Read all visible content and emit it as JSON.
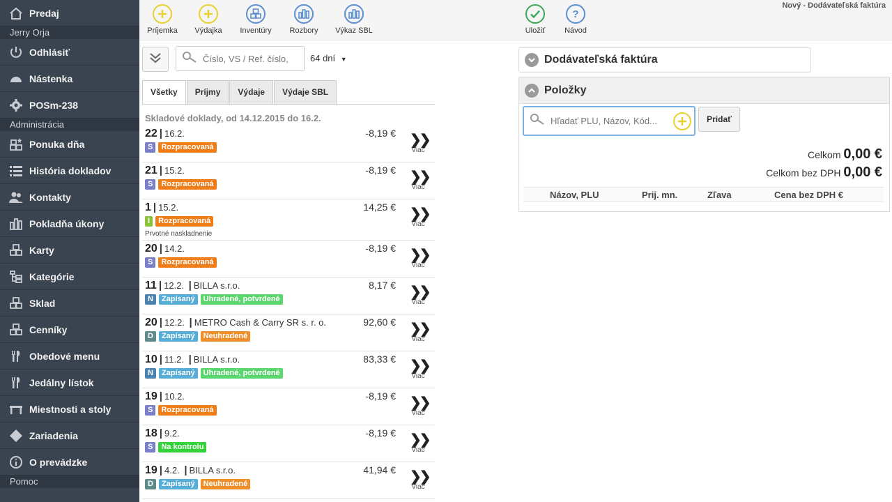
{
  "sidebar": {
    "items": [
      {
        "label": "Predaj",
        "icon": "home-icon"
      },
      {
        "section": "Jerry Orja"
      },
      {
        "label": "Odhlásiť",
        "icon": "power-icon"
      },
      {
        "label": "Nástenka",
        "icon": "dashboard-icon"
      },
      {
        "label": "POSm-238",
        "icon": "gear-icon"
      },
      {
        "section": "Administrácia"
      },
      {
        "label": "Ponuka dňa",
        "icon": "blocks-star-icon"
      },
      {
        "label": "História dokladov",
        "icon": "list-icon"
      },
      {
        "label": "Kontakty",
        "icon": "users-icon"
      },
      {
        "label": "Pokladňa úkony",
        "icon": "bars-icon"
      },
      {
        "label": "Karty",
        "icon": "blocks-icon"
      },
      {
        "label": "Kategórie",
        "icon": "tree-icon"
      },
      {
        "label": "Sklad",
        "icon": "blocks-icon"
      },
      {
        "label": "Cenníky",
        "icon": "blocks-icon"
      },
      {
        "label": "Obedové menu",
        "icon": "cutlery-icon"
      },
      {
        "label": "Jedálny lístok",
        "icon": "cutlery-icon"
      },
      {
        "label": "Miestnosti a stoly",
        "icon": "table-icon"
      },
      {
        "label": "Zariadenia",
        "icon": "diamond-icon"
      },
      {
        "label": "O prevádzke",
        "icon": "info-icon"
      },
      {
        "section": "Pomoc"
      }
    ]
  },
  "toolbar": {
    "prijemka": "Príjemka",
    "vydajka": "Výdajka",
    "inventury": "Inventúry",
    "rozbory": "Rozbory",
    "vykaz": "Výkaz SBL",
    "ulozit": "Uložiť",
    "navod": "Návod",
    "title": "Nový - Dodávateľská faktúra"
  },
  "list": {
    "search_placeholder": "Číslo, VS / Ref. číslo,",
    "days": "64 dní",
    "tabs": [
      "Všetky",
      "Príjmy",
      "Výdaje",
      "Výdaje SBL"
    ],
    "header": "Skladové doklady, od 14.12.2015 do 16.2.",
    "more_label": "Viac",
    "docs": [
      {
        "num": "22",
        "date": "16.2.",
        "partner": "",
        "amount": "-8,19 €",
        "type": "S",
        "badges": [
          {
            "t": "Rozpracovaná",
            "c": "roz"
          }
        ],
        "note": ""
      },
      {
        "num": "21",
        "date": "15.2.",
        "partner": "",
        "amount": "-8,19 €",
        "type": "S",
        "badges": [
          {
            "t": "Rozpracovaná",
            "c": "roz"
          }
        ],
        "note": ""
      },
      {
        "num": "1",
        "date": "15.2.",
        "partner": "",
        "amount": "14,25 €",
        "type": "I",
        "badges": [
          {
            "t": "Rozpracovaná",
            "c": "roz"
          }
        ],
        "note": "Prvotné naskladnenie"
      },
      {
        "num": "20",
        "date": "14.2.",
        "partner": "",
        "amount": "-8,19 €",
        "type": "S",
        "badges": [
          {
            "t": "Rozpracovaná",
            "c": "roz"
          }
        ],
        "note": ""
      },
      {
        "num": "11",
        "date": "12.2.",
        "partner": "BILLA s.r.o.",
        "amount": "8,17 €",
        "type": "N",
        "badges": [
          {
            "t": "Zapísaný",
            "c": "zap"
          },
          {
            "t": "Uhradené, potvrdené",
            "c": "uhr"
          }
        ],
        "note": ""
      },
      {
        "num": "20",
        "date": "12.2.",
        "partner": "METRO Cash & Carry SR s. r. o.",
        "amount": "92,60 €",
        "type": "D",
        "badges": [
          {
            "t": "Zapísaný",
            "c": "zap"
          },
          {
            "t": "Neuhradené",
            "c": "neu"
          }
        ],
        "note": ""
      },
      {
        "num": "10",
        "date": "11.2.",
        "partner": "BILLA s.r.o.",
        "amount": "83,33 €",
        "type": "N",
        "badges": [
          {
            "t": "Zapísaný",
            "c": "zap"
          },
          {
            "t": "Uhradené, potvrdené",
            "c": "uhr"
          }
        ],
        "note": ""
      },
      {
        "num": "19",
        "date": "10.2.",
        "partner": "",
        "amount": "-8,19 €",
        "type": "S",
        "badges": [
          {
            "t": "Rozpracovaná",
            "c": "roz"
          }
        ],
        "note": ""
      },
      {
        "num": "18",
        "date": "9.2.",
        "partner": "",
        "amount": "-8,19 €",
        "type": "S",
        "badges": [
          {
            "t": "Na kontrolu",
            "c": "kon"
          }
        ],
        "note": ""
      },
      {
        "num": "19",
        "date": "4.2.",
        "partner": "BILLA s.r.o.",
        "amount": "41,94 €",
        "type": "D",
        "badges": [
          {
            "t": "Zapísaný",
            "c": "zap"
          },
          {
            "t": "Neuhradené",
            "c": "neu"
          }
        ],
        "note": ""
      }
    ]
  },
  "invoice": {
    "section_title": "Dodávateľská faktúra",
    "items_title": "Položky",
    "item_search_placeholder": "Hľadať PLU, Názov, Kód...",
    "add_label": "Pridať",
    "total_label": "Celkom",
    "total_value": "0,00 €",
    "total_novat_label": "Celkom bez DPH",
    "total_novat_value": "0,00 €",
    "columns": [
      "Názov, PLU",
      "Prij. mn.",
      "Zľava",
      "Cena bez DPH €"
    ]
  }
}
